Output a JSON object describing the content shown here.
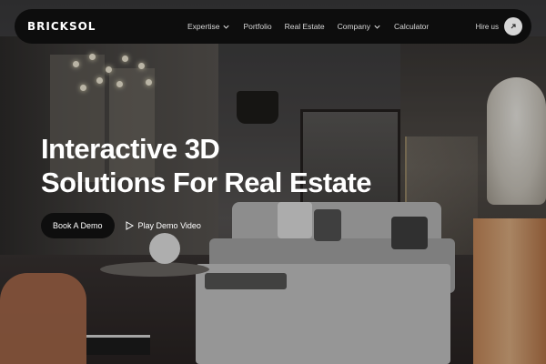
{
  "brand": {
    "logo_text": "BRICKSOL"
  },
  "nav": {
    "items": [
      {
        "label": "Expertise",
        "has_dropdown": true
      },
      {
        "label": "Portfolio",
        "has_dropdown": false
      },
      {
        "label": "Real Estate",
        "has_dropdown": false
      },
      {
        "label": "Company",
        "has_dropdown": true
      },
      {
        "label": "Calculator",
        "has_dropdown": false
      }
    ],
    "hire_label": "Hire us",
    "hire_icon": "arrow-up-right-icon"
  },
  "hero": {
    "headline_line1": "Interactive 3D",
    "headline_line2": "Solutions For Real Estate",
    "primary_cta": "Book A Demo",
    "secondary_cta": "Play Demo Video",
    "secondary_icon": "play-icon"
  },
  "colors": {
    "nav_bg": "#0d0d0d",
    "button_bg": "#0e0e0e",
    "text_light": "#ffffff"
  }
}
